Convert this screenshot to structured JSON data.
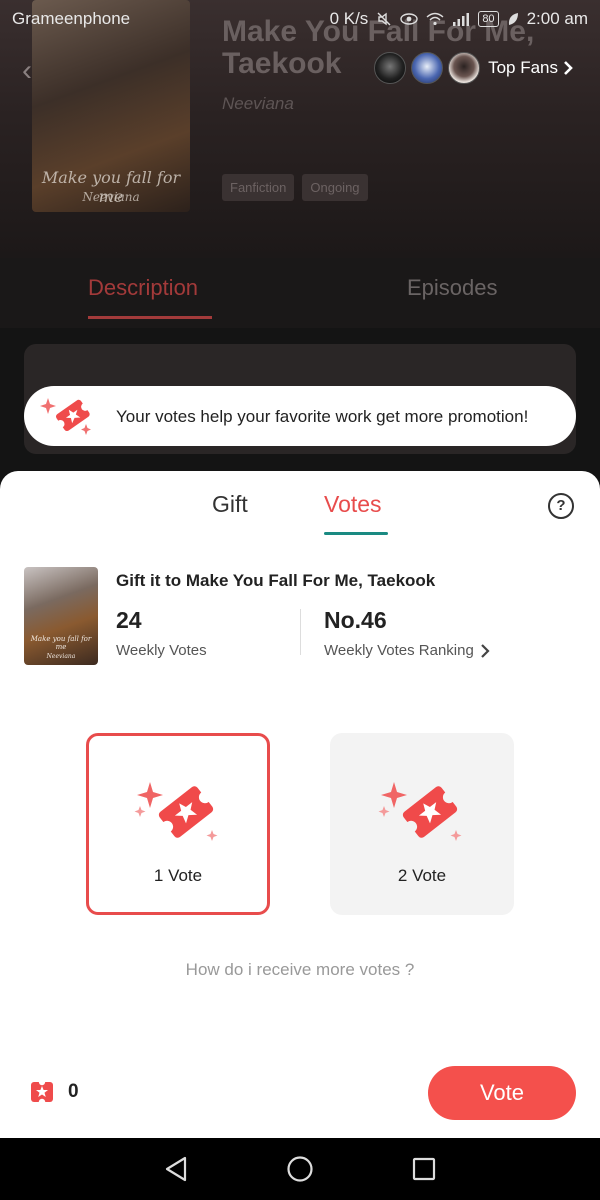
{
  "status_bar": {
    "carrier": "Grameenphone",
    "net_speed": "0 K/s",
    "battery": "80",
    "time": "2:00 am"
  },
  "book_header": {
    "title": "Make You Fall For Me, Taekook",
    "author": "Neeviana",
    "cover_script": "Make you fall for me",
    "cover_author": "Neeviana",
    "tags": [
      "Fanfiction",
      "Ongoing"
    ],
    "top_fans_label": "Top Fans"
  },
  "book_tabs": {
    "description": "Description",
    "episodes": "Episodes"
  },
  "toast": {
    "message": "Your votes help your favorite work get more promotion!"
  },
  "sheet": {
    "tabs": {
      "gift": "Gift",
      "votes": "Votes",
      "active": "votes"
    },
    "gift_title": "Gift it to Make You Fall For Me, Taekook",
    "weekly_votes": {
      "value": "24",
      "label": "Weekly Votes"
    },
    "ranking": {
      "value": "No.46",
      "label": "Weekly Votes Ranking"
    },
    "options": [
      {
        "label": "1 Vote",
        "selected": true
      },
      {
        "label": "2 Vote",
        "selected": false
      }
    ],
    "more_votes_link": "How do i receive more votes ?",
    "balance": "0",
    "vote_button": "Vote"
  },
  "colors": {
    "accent": "#e84c4c",
    "button": "#f4504c",
    "underline": "#1a8a82"
  }
}
